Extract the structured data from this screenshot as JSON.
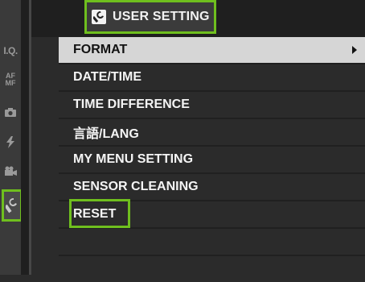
{
  "colors": {
    "highlight_green": "#6fbf1e",
    "selected_row": "#d6d6d6",
    "background": "#2b2b2b"
  },
  "header": {
    "title": "USER SETTING",
    "icon": "wrench-icon"
  },
  "tabs": [
    {
      "label": "I.Q."
    },
    {
      "label_top": "AF",
      "label_bottom": "MF"
    },
    {
      "icon": "camera-icon"
    },
    {
      "icon": "flash-icon"
    },
    {
      "icon": "movie-camera-icon"
    },
    {
      "icon": "wrench-icon",
      "active": true
    }
  ],
  "menu": {
    "items": [
      {
        "label": "FORMAT",
        "selected": true,
        "has_submenu": true
      },
      {
        "label": "DATE/TIME"
      },
      {
        "label": "TIME DIFFERENCE"
      },
      {
        "label": "言語/LANG"
      },
      {
        "label": "MY MENU SETTING"
      },
      {
        "label": "SENSOR CLEANING"
      },
      {
        "label": "RESET",
        "highlighted": true
      },
      {
        "label": ""
      },
      {
        "label": ""
      }
    ]
  }
}
